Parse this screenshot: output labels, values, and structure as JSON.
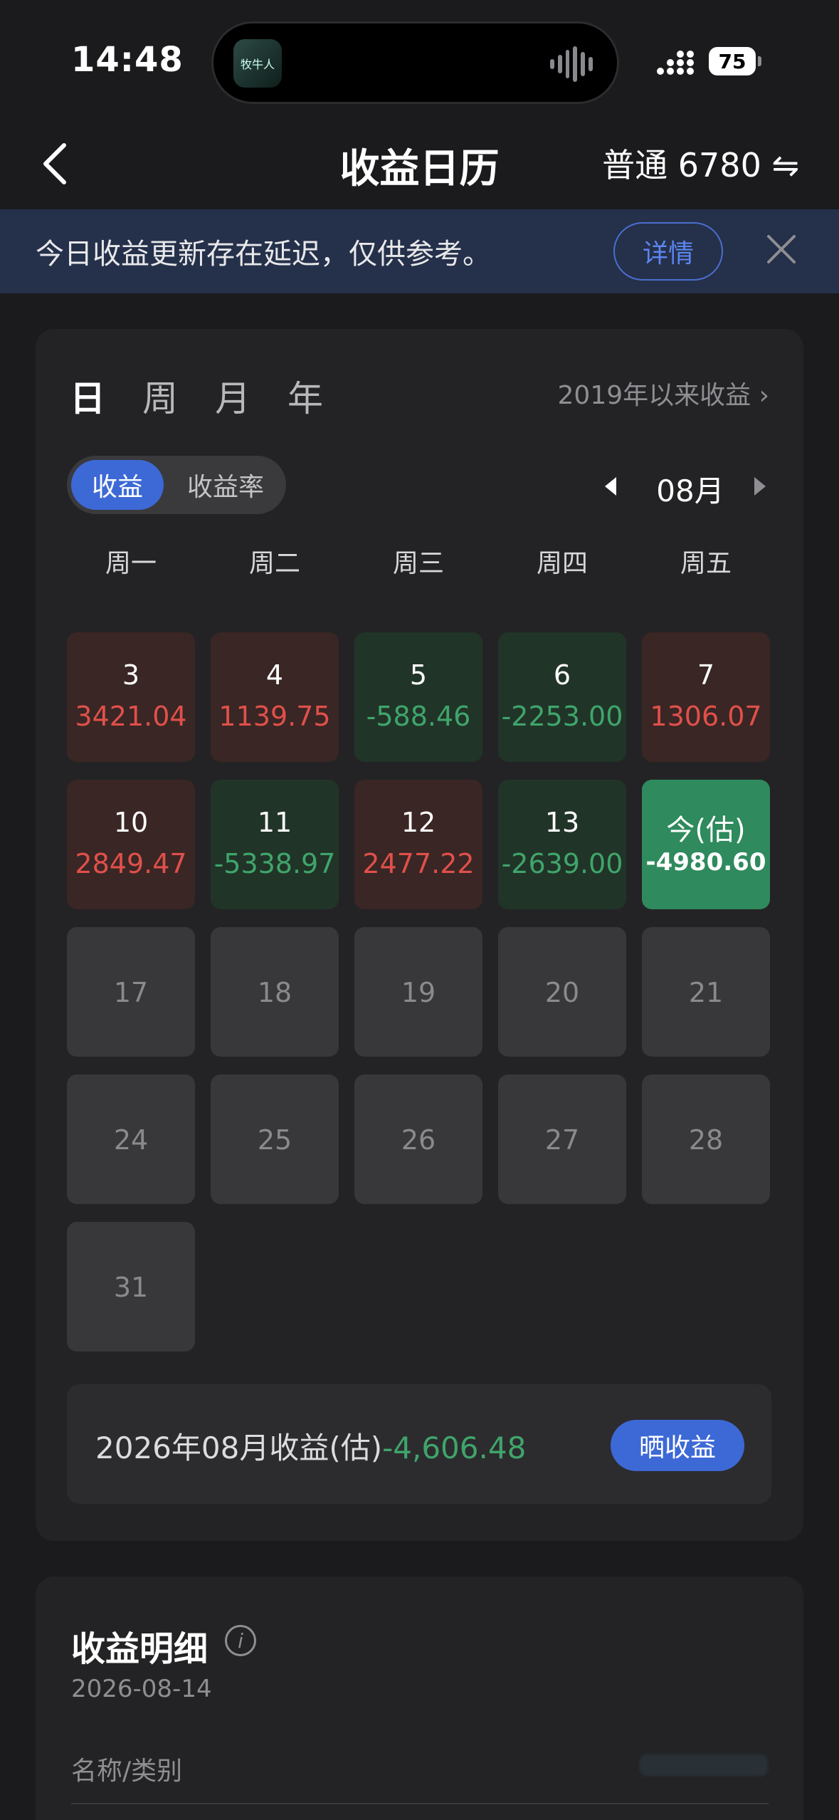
{
  "status_bar": {
    "time": "14:48",
    "battery": "75",
    "app_icon_text": "牧牛人"
  },
  "nav": {
    "title": "收益日历",
    "account": "普通 6780 ⇋"
  },
  "banner": {
    "text": "今日收益更新存在延迟，仅供参考。",
    "detail_label": "详情"
  },
  "calendar": {
    "period_tabs": [
      "日",
      "周",
      "月",
      "年"
    ],
    "since_label": "2019年以来收益 ›",
    "toggle": {
      "on": "收益",
      "off": "收益率"
    },
    "month": "08月",
    "weekdays": [
      "周一",
      "周二",
      "周三",
      "周四",
      "周五"
    ],
    "cells": [
      {
        "day": "3",
        "value": "3421.04"
      },
      {
        "day": "4",
        "value": "1139.75"
      },
      {
        "day": "5",
        "value": "-588.46"
      },
      {
        "day": "6",
        "value": "-2253.00"
      },
      {
        "day": "7",
        "value": "1306.07"
      },
      {
        "day": "10",
        "value": "2849.47"
      },
      {
        "day": "11",
        "value": "-5338.97"
      },
      {
        "day": "12",
        "value": "2477.22"
      },
      {
        "day": "13",
        "value": "-2639.00"
      },
      {
        "day": "今(估)",
        "value": "-4980.60"
      },
      {
        "day": "17"
      },
      {
        "day": "18"
      },
      {
        "day": "19"
      },
      {
        "day": "20"
      },
      {
        "day": "21"
      },
      {
        "day": "24"
      },
      {
        "day": "25"
      },
      {
        "day": "26"
      },
      {
        "day": "27"
      },
      {
        "day": "28"
      },
      {
        "day": "31"
      }
    ],
    "summary_label": "2026年08月收益(估)",
    "summary_value": "-4,606.48",
    "share_label": "晒收益"
  },
  "details": {
    "title": "收益明细",
    "date": "2026-08-14",
    "column_header": "名称/类别"
  },
  "colors": {
    "up": "#e0504b",
    "down": "#3fa56b",
    "accent": "#3d69d6",
    "today": "#2f8a5d"
  }
}
